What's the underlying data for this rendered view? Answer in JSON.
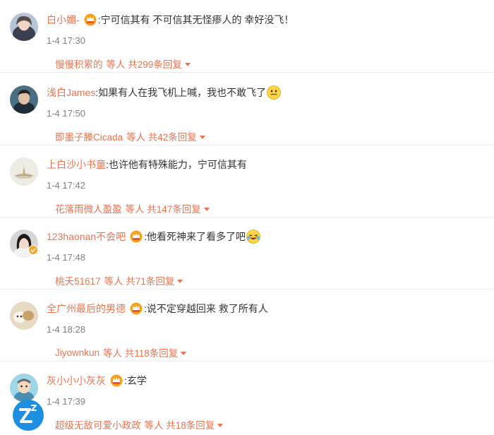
{
  "comments": [
    {
      "user": "白小媚-",
      "badge": "vip-crown-badge",
      "text": ":宁可信其有 不可信其无怪瘆人的 幸好没飞！",
      "time": "1-4 17:30",
      "reply_user": "慢慢积累的",
      "reply_suffix": "等人 共299条回复"
    },
    {
      "user": "浅白James",
      "text": ":如果有人在我飞机上喊，我也不敢飞了",
      "emoji": "nervous-smile-emoji",
      "time": "1-4 17:50",
      "reply_user": "即墨子滕Cicada",
      "reply_suffix": "等人 共42条回复"
    },
    {
      "user": "上白沙小书童",
      "text": ":也许他有特殊能力，宁可信其有",
      "time": "1-4 17:42",
      "reply_user": "花落雨微人盈盈",
      "reply_suffix": "等人 共147条回复"
    },
    {
      "user": "123haonan不会吧",
      "badge": "vip-crown-badge",
      "text": ":他看死神来了看多了吧",
      "emoji": "laugh-tears-emoji",
      "time": "1-4 17:48",
      "reply_user": "桃夭51617",
      "reply_suffix": "等人 共71条回复"
    },
    {
      "user": "全广州最后的男德",
      "badge": "vip-crown-badge",
      "text": ":说不定穿越回来 救了所有人",
      "time": "1-4 18:28",
      "reply_user": "Jiyownkun",
      "reply_suffix": "等人 共118条回复"
    },
    {
      "user": "灰小小小灰灰",
      "badge": "vip-crown-badge",
      "text": ":玄学",
      "time": "1-4 17:39",
      "reply_user": "超级无敌可爱小政政",
      "reply_suffix": "等人 共18条回复"
    }
  ],
  "colors": {
    "username": "#eb7350",
    "time": "#808080",
    "text": "#333333"
  }
}
